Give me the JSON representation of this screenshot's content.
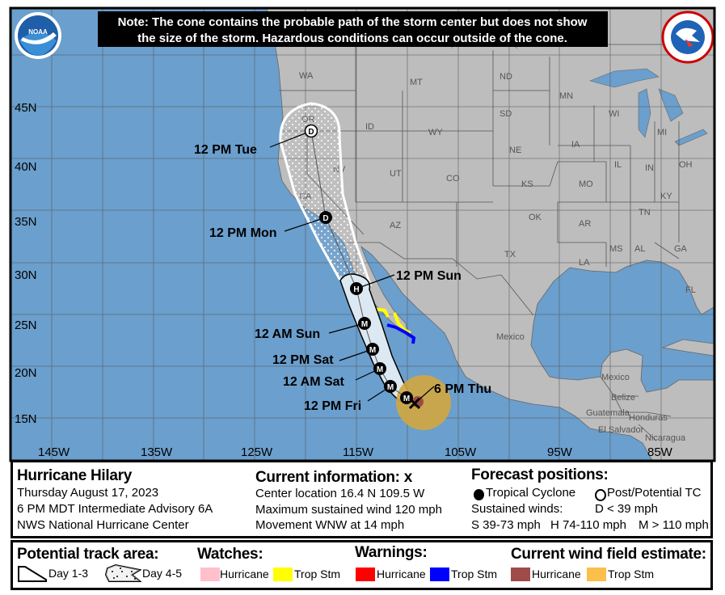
{
  "note": {
    "line1": "Note: The cone contains the probable path of the storm center but does not show",
    "line2": "the size of the storm. Hazardous conditions can occur outside of the cone."
  },
  "logos": {
    "left": "NOAA",
    "right": "NATIONAL WEATHER SERVICE"
  },
  "map": {
    "lat_labels": [
      "45N",
      "40N",
      "35N",
      "30N",
      "25N",
      "20N",
      "15N"
    ],
    "lon_labels": [
      "145W",
      "135W",
      "125W",
      "115W",
      "105W",
      "95W",
      "85W"
    ],
    "state_labels": [
      "WA",
      "OR",
      "ID",
      "MT",
      "ND",
      "SD",
      "WY",
      "NE",
      "UT",
      "CO",
      "KS",
      "NV",
      "CA",
      "AZ",
      "OK",
      "TX",
      "MN",
      "WI",
      "MI",
      "IA",
      "IL",
      "IN",
      "OH",
      "MO",
      "KY",
      "TN",
      "AR",
      "MS",
      "AL",
      "GA",
      "LA",
      "FL",
      "Mexico",
      "Mexico",
      "Belize",
      "Guatemala",
      "Honduras",
      "El Salvador",
      "Nicaragua"
    ],
    "colors": {
      "ocean": "#6b9fcd",
      "land": "#bdbdbd",
      "cone_day13": "#dce8f2",
      "wind_ts": "#d3a640",
      "wind_hu": "#9e4b45",
      "watch_ts": "#ffff00",
      "warn_ts": "#0000ff"
    },
    "forecast_points": [
      {
        "label": "6 PM Thu",
        "type": "X"
      },
      {
        "label": "12 PM Fri",
        "type": "M"
      },
      {
        "label": "12 AM Sat",
        "type": "M"
      },
      {
        "label": "12 PM Sat",
        "type": "M"
      },
      {
        "label": "12 AM Sun",
        "type": "M"
      },
      {
        "label": "12 PM Sun",
        "type": "H"
      },
      {
        "label": "12 PM Mon",
        "type": "D"
      },
      {
        "label": "12 PM Tue",
        "type": "D"
      }
    ],
    "extra_m_point": "M"
  },
  "info": {
    "storm_name": "Hurricane Hilary",
    "date": "Thursday August 17, 2023",
    "advisory": "6 PM MDT Intermediate Advisory 6A",
    "center": "NWS National Hurricane Center",
    "current_title": "Current information: ",
    "current_icon": "x-mark",
    "current_x": "x",
    "location": "Center location 16.4 N 109.5 W",
    "max_wind": "Maximum sustained wind 120 mph",
    "movement": "Movement WNW at 14 mph",
    "forecast_title": "Forecast positions:",
    "tropical_cyclone": "Tropical Cyclone",
    "post_potential": "Post/Potential TC",
    "sustained_winds": "Sustained winds:",
    "d_scale": "D < 39 mph",
    "s_scale": "S 39-73 mph",
    "h_scale": "H 74-110 mph",
    "m_scale": "M > 110 mph"
  },
  "legend": {
    "track_title": "Potential track area:",
    "day13": "Day 1-3",
    "day45": "Day 4-5",
    "watches_title": "Watches:",
    "watch_hurricane": "Hurricane",
    "watch_ts": "Trop Stm",
    "warnings_title": "Warnings:",
    "warn_hurricane": "Hurricane",
    "warn_ts": "Trop Stm",
    "wind_title": "Current wind field estimate:",
    "wind_hurricane": "Hurricane",
    "wind_ts": "Trop Stm",
    "colors": {
      "watch_hurricane": "#ffc0cb",
      "watch_ts": "#ffff00",
      "warn_hurricane": "#ff0000",
      "warn_ts": "#0000ff",
      "wind_hurricane": "#a04a4a",
      "wind_ts": "#fcbf4a"
    }
  }
}
